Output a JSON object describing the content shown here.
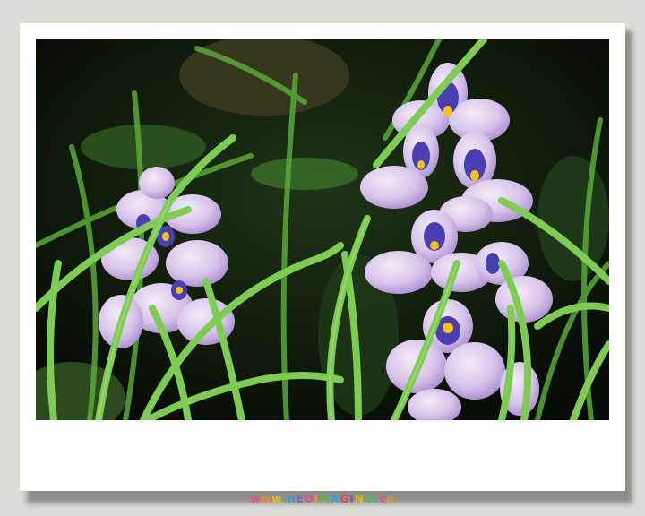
{
  "watermark": {
    "text": "www.nEOIMAGING.cn",
    "colors": [
      "#e84c8a",
      "#f28d2c",
      "#e2c21a",
      "#5bb848",
      "#2f9fd6",
      "#7a5cc8",
      "#e84c8a",
      "#f28d2c",
      "#5bb848",
      "#2f9fd6",
      "#d94a4a",
      "#7a5cc8",
      "#e2c21a",
      "#5bb848",
      "#2f9fd6",
      "#e84c8a",
      "#f28d2c"
    ]
  },
  "photo": {
    "subject": "water hyacinth flowers among grass",
    "colors": {
      "background": "#0b140a",
      "grass": "#6fbd4a",
      "petal": "#d9c6ea",
      "petal_shade": "#b79fd9",
      "eye_blue": "#4a3fb0",
      "eye_yellow": "#f2c21a"
    }
  }
}
